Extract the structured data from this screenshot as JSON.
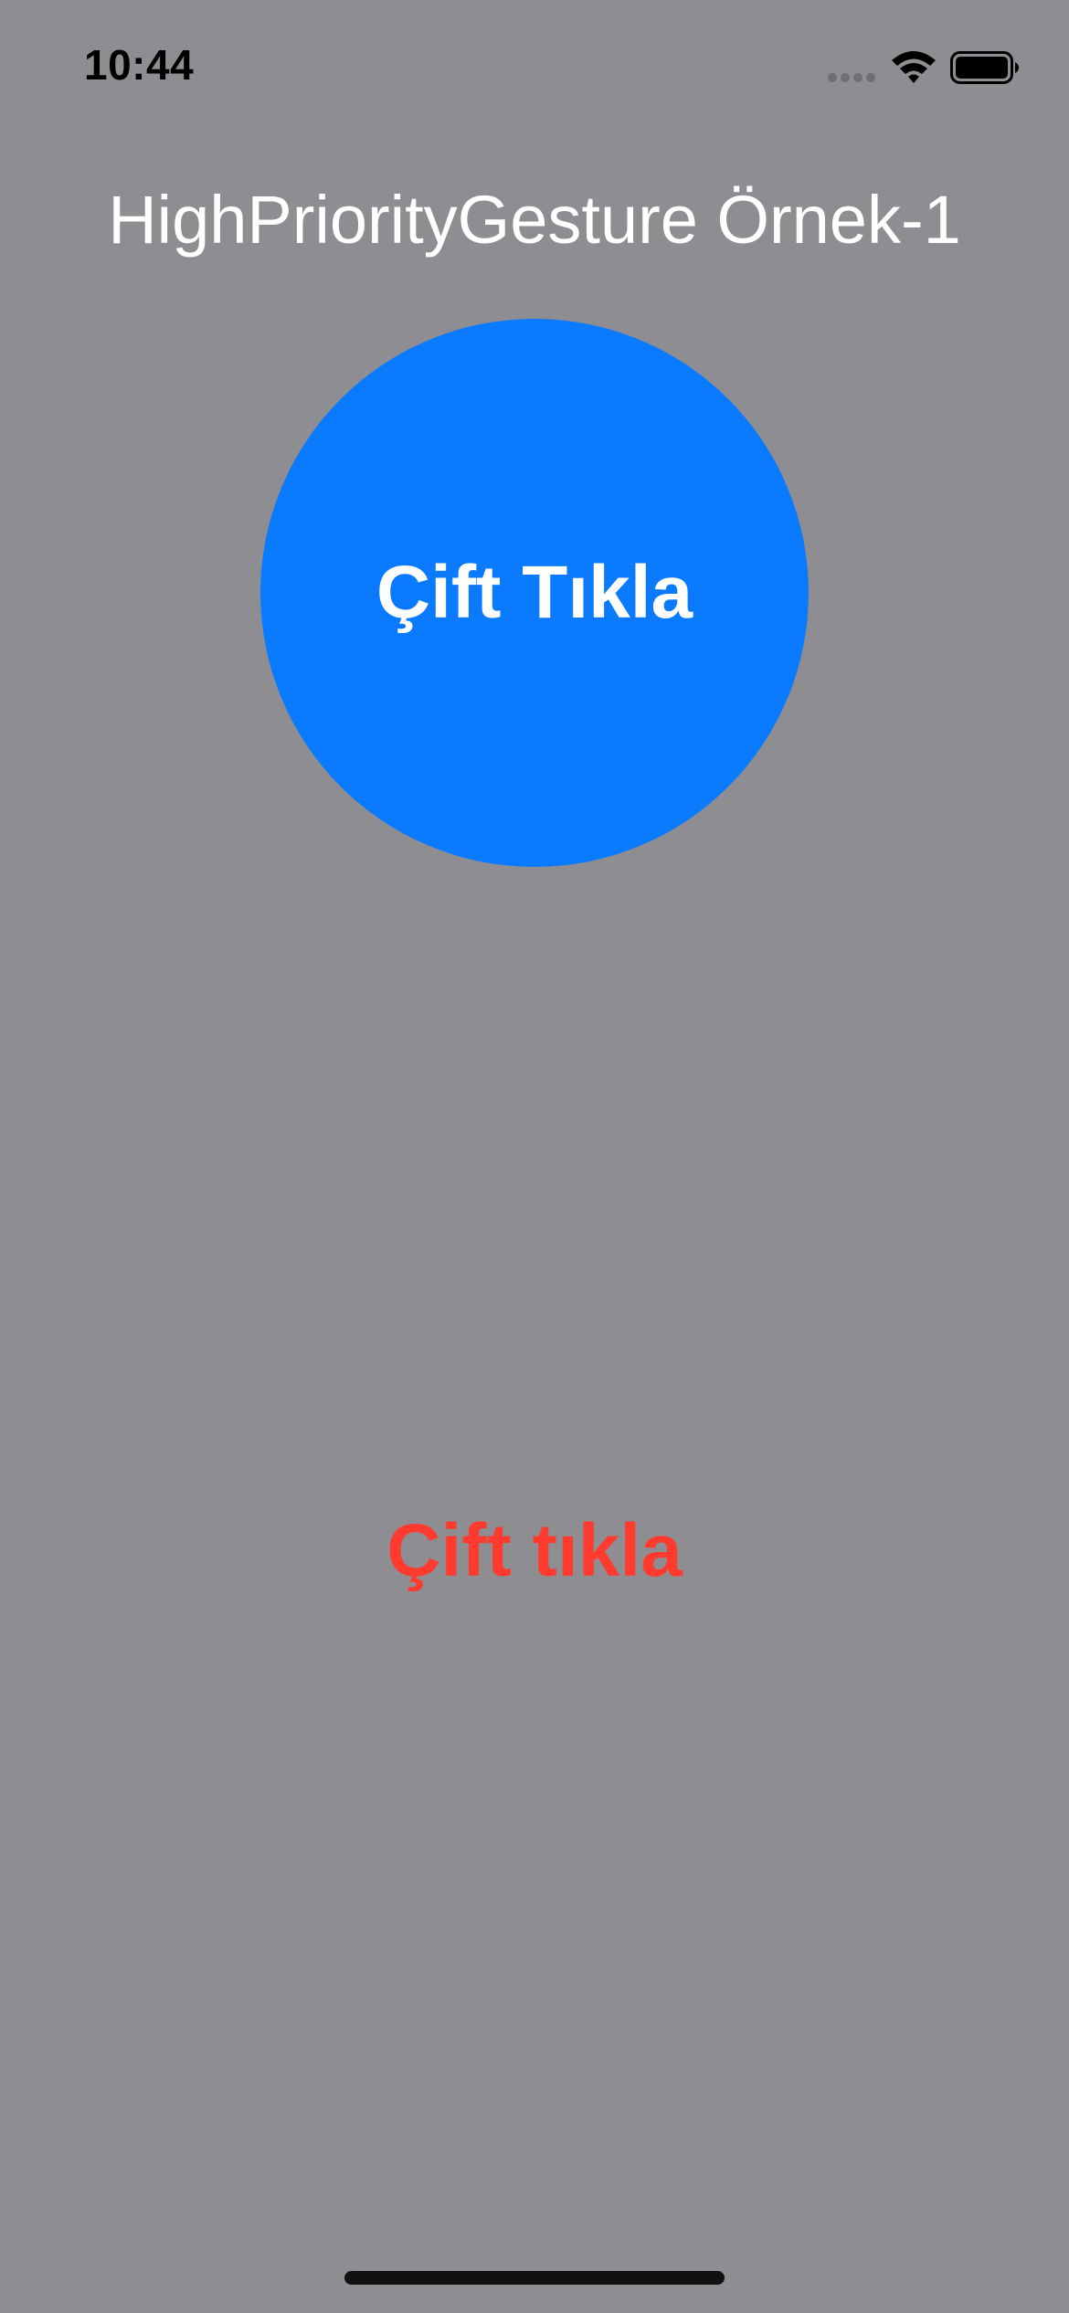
{
  "status_bar": {
    "time": "10:44"
  },
  "header": {
    "title": "HighPriorityGesture Örnek-1"
  },
  "circle_button": {
    "label": "Çift Tıkla",
    "color": "#0a7aff"
  },
  "status_message": {
    "text": "Çift tıkla",
    "color": "#ff3b30"
  },
  "icons": {
    "cellular": "cellular-signal-icon",
    "wifi": "wifi-icon",
    "battery": "battery-icon"
  },
  "colors": {
    "background": "#8e8d92",
    "title_text": "#ffffff"
  }
}
